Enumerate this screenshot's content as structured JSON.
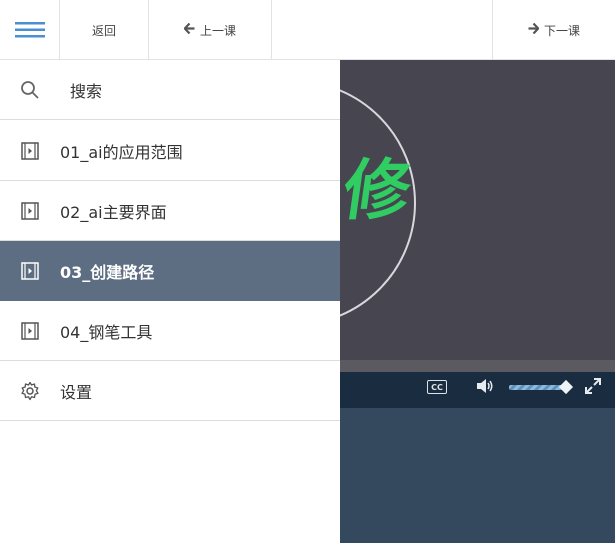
{
  "toolbar": {
    "menu_icon": "hamburger-menu-icon",
    "back_label": "返回",
    "prev_label": "上一课",
    "next_label": "下一课",
    "prev_icon": "arrow-left-icon",
    "next_icon": "arrow-right-icon"
  },
  "sidebar": {
    "search_label": "搜索",
    "items": [
      {
        "label": "01_ai的应用范围",
        "icon": "film-icon",
        "active": false
      },
      {
        "label": "02_ai主要界面",
        "icon": "film-icon",
        "active": false
      },
      {
        "label": "03_创建路径",
        "icon": "film-icon",
        "active": true
      },
      {
        "label": "04_钢笔工具",
        "icon": "film-icon",
        "active": false
      }
    ],
    "settings_label": "设置"
  },
  "video": {
    "glyph_text": "修",
    "cc_label": "CC",
    "volume_level": 0.95
  },
  "colors": {
    "active_row": "#5e6e82",
    "video_bg": "#474650",
    "control_bar": "#1a2c3f",
    "below_video": "#34495e",
    "accent_blue": "#4a8fd0",
    "glyph_green": "#2fcd62"
  }
}
